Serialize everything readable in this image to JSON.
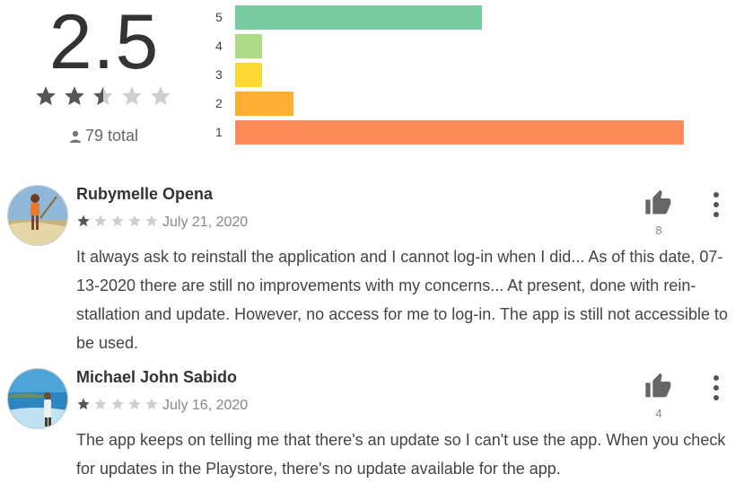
{
  "summary": {
    "score": "2.5",
    "rating": 2.5,
    "total": "79 total",
    "icon": "person-icon"
  },
  "histogram": {
    "colors": {
      "5": "#77c9a0",
      "4": "#aedb88",
      "3": "#fdd835",
      "2": "#ffb034",
      "1": "#ff8c5a"
    },
    "rows": [
      {
        "label": "5",
        "fraction": 0.55
      },
      {
        "label": "4",
        "fraction": 0.06
      },
      {
        "label": "3",
        "fraction": 0.06
      },
      {
        "label": "2",
        "fraction": 0.13
      },
      {
        "label": "1",
        "fraction": 1.0
      }
    ]
  },
  "reviews": [
    {
      "name": "Rubymelle Opena",
      "rating": 1,
      "date": "July 21, 2020",
      "likes": "8",
      "body": "It always ask to reinstall the application and I cannot log-in when I did... As of this date, 07-13-2020 there are still no improvements with my concerns... At present, done with rein-stallation and update. However, no access for me to log-in. The app is still not accessible to be used."
    },
    {
      "name": "Michael John Sabido",
      "rating": 1,
      "date": "July 16, 2020",
      "likes": "4",
      "body": "The app keeps on telling me that there's an update so I can't use the app. When you check for updates in the Playstore, there's no update available for the app."
    }
  ],
  "colors": {
    "star_filled": "#555555",
    "star_empty": "#cfcfcf"
  }
}
